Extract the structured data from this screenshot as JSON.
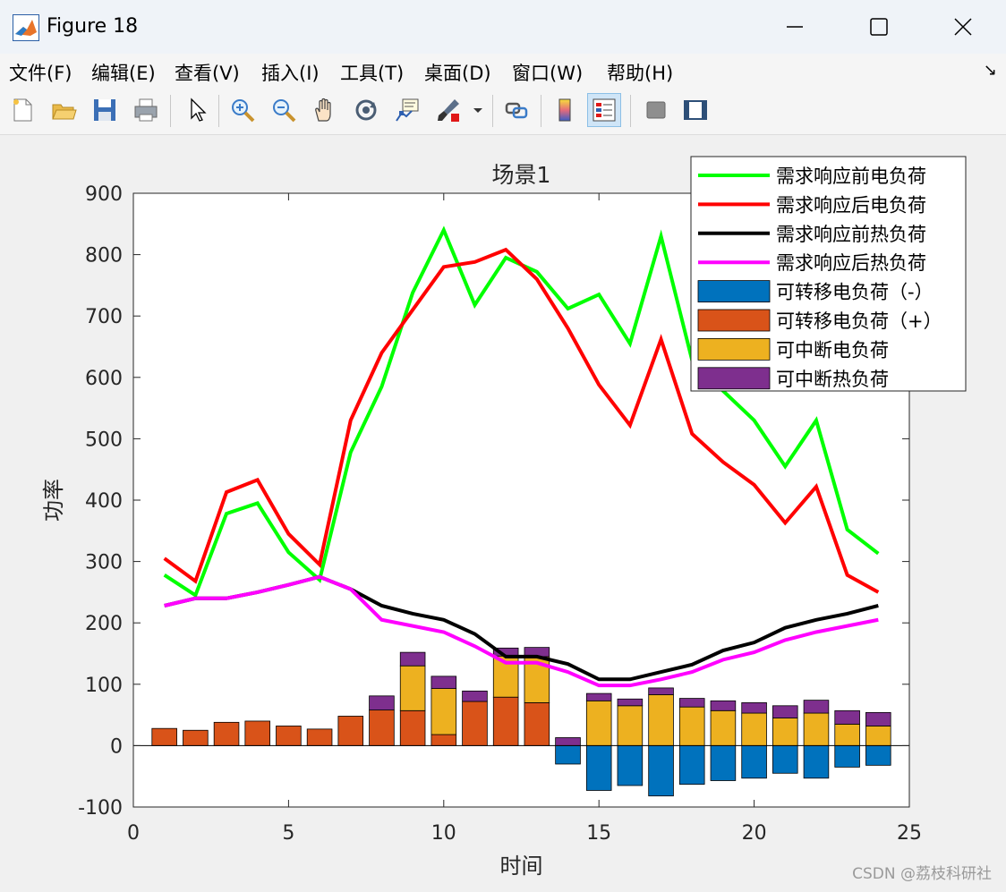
{
  "window": {
    "title": "Figure 18",
    "minimize_icon": "minimize-icon",
    "maximize_icon": "maximize-icon",
    "close_icon": "close-icon"
  },
  "menu": [
    "文件(F)",
    "编辑(E)",
    "查看(V)",
    "插入(I)",
    "工具(T)",
    "桌面(D)",
    "窗口(W)",
    "帮助(H)"
  ],
  "toolbar": {
    "icons": [
      "new-figure-icon",
      "open-file-icon",
      "save-icon",
      "print-icon",
      "pointer-icon",
      "zoom-in-icon",
      "zoom-out-icon",
      "pan-hand-icon",
      "rotate-3d-icon",
      "data-cursor-icon",
      "brush-icon",
      "brush-dropdown-icon",
      "link-plot-icon",
      "colorbar-icon",
      "legend-icon",
      "hide-plot-tools-icon",
      "show-plot-tools-icon"
    ]
  },
  "watermark": "CSDN @荔枝科研社",
  "chart_data": {
    "type": "bar",
    "title": "场景1",
    "xlabel": "时间",
    "ylabel": "功率",
    "xlim": [
      0,
      25
    ],
    "ylim": [
      -100,
      900
    ],
    "xticks": [
      0,
      5,
      10,
      15,
      20,
      25
    ],
    "yticks": [
      -100,
      0,
      100,
      200,
      300,
      400,
      500,
      600,
      700,
      800,
      900
    ],
    "grid": false,
    "legend_location": "top-right",
    "x": [
      1,
      2,
      3,
      4,
      5,
      6,
      7,
      8,
      9,
      10,
      11,
      12,
      13,
      14,
      15,
      16,
      17,
      18,
      19,
      20,
      21,
      22,
      23,
      24
    ],
    "lines": [
      {
        "name": "需求响应前电负荷",
        "color": "#00ff00",
        "values": [
          278,
          245,
          378,
          395,
          315,
          270,
          478,
          585,
          738,
          840,
          718,
          795,
          772,
          712,
          735,
          655,
          830,
          628,
          578,
          530,
          455,
          530,
          352,
          313
        ]
      },
      {
        "name": "需求响应后电负荷",
        "color": "#ff0000",
        "values": [
          305,
          268,
          413,
          433,
          345,
          295,
          530,
          640,
          710,
          780,
          788,
          808,
          760,
          680,
          588,
          522,
          662,
          508,
          462,
          425,
          363,
          422,
          278,
          250
        ]
      },
      {
        "name": "需求响应前热负荷",
        "color": "#000000",
        "values": [
          228,
          240,
          240,
          250,
          262,
          275,
          255,
          228,
          215,
          205,
          182,
          145,
          145,
          133,
          108,
          108,
          120,
          132,
          155,
          168,
          192,
          205,
          215,
          228
        ]
      },
      {
        "name": "需求响应后热负荷",
        "color": "#ff00ff",
        "values": [
          228,
          240,
          240,
          250,
          262,
          275,
          255,
          205,
          195,
          185,
          162,
          135,
          135,
          120,
          98,
          98,
          108,
          120,
          140,
          152,
          172,
          185,
          195,
          205
        ]
      }
    ],
    "bars": [
      {
        "name": "可转移电负荷（-）",
        "color": "#0072bd",
        "values": [
          0,
          0,
          0,
          0,
          0,
          0,
          0,
          0,
          0,
          0,
          0,
          0,
          0,
          -30,
          -73,
          -65,
          -82,
          -63,
          -57,
          -53,
          -45,
          -53,
          -35,
          -32
        ]
      },
      {
        "name": "可转移电负荷（+）",
        "color": "#d95319",
        "values": [
          28,
          25,
          38,
          40,
          32,
          27,
          48,
          58,
          57,
          18,
          72,
          79,
          70,
          0,
          0,
          0,
          0,
          0,
          0,
          0,
          0,
          0,
          0,
          0
        ]
      },
      {
        "name": "可中断电负荷",
        "color": "#edb120",
        "values": [
          0,
          0,
          0,
          0,
          0,
          0,
          0,
          0,
          73,
          75,
          0,
          67,
          75,
          0,
          73,
          65,
          83,
          63,
          57,
          53,
          45,
          53,
          35,
          32
        ]
      },
      {
        "name": "可中断热负荷",
        "color": "#7e2f8e",
        "values": [
          0,
          0,
          0,
          0,
          0,
          0,
          0,
          23,
          22,
          20,
          17,
          13,
          15,
          13,
          12,
          11,
          11,
          14,
          16,
          17,
          20,
          21,
          22,
          22
        ]
      }
    ]
  }
}
